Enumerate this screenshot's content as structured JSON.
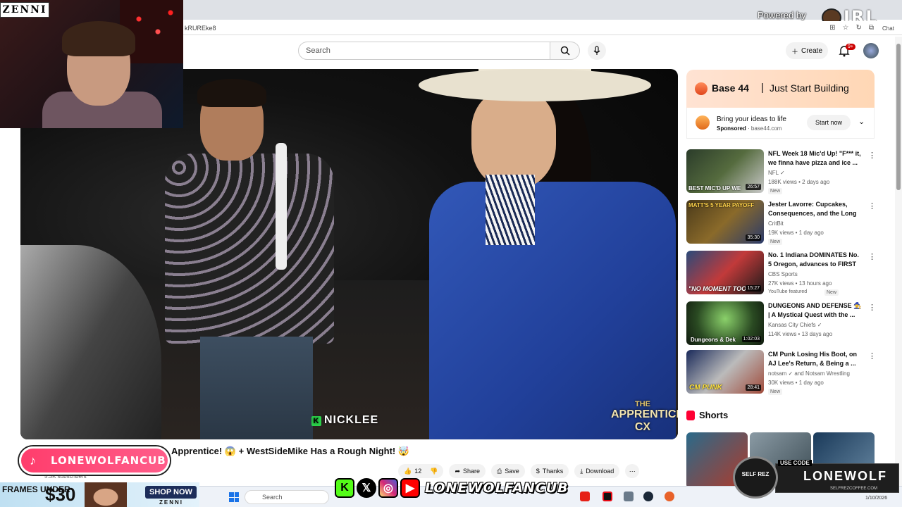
{
  "browser": {
    "url_fragment": "kRUREke8",
    "powered_by": "Powered by",
    "logo_text": "IRL",
    "chat_label": "Chat"
  },
  "youtube_header": {
    "search_placeholder": "Search",
    "create_label": "Create",
    "notifications_badge": "9+"
  },
  "video": {
    "caption_name": "NICKLEE",
    "caption_icon_letter": "K",
    "watermark_line1": "THE",
    "watermark_line2": "APPRENTICE",
    "watermark_line3": "CX",
    "title": "Apprentice! 😱 + WestSideMike Has a Rough Night! 🤯",
    "subscribers": "5.3K subscribers",
    "likes": "12",
    "share_label": "Share",
    "save_label": "Save",
    "thanks_label": "Thanks",
    "download_label": "Download"
  },
  "ad": {
    "brand": "Base 44",
    "separator": "|",
    "tagline": "Just Start Building",
    "headline": "Bring your ideas to life",
    "sponsored": "Sponsored",
    "domain": "base44.com",
    "cta": "Start now"
  },
  "recommendations": [
    {
      "title": "NFL Week 18 Mic'd Up! \"F*** it, we finna have pizza and ice ...",
      "channel": "NFL ✓",
      "meta": "188K views • 2 days ago",
      "badge": "New",
      "duration": "26:57",
      "thumb_text": "BEST MIC'D UP WE"
    },
    {
      "title": "Jester Lavorre: Cupcakes, Consequences, and the Long ...",
      "channel": "CritBit",
      "meta": "19K views • 1 day ago",
      "badge": "New",
      "duration": "35:30",
      "thumb_text": "MATT'S 5 YEAR PAYOFF"
    },
    {
      "title": "No. 1 Indiana DOMINATES No. 5 Oregon, advances to FIRST ...",
      "channel": "CBS Sports",
      "meta": "27K views • 13 hours ago",
      "badge": "New",
      "extra": "YouTube featured",
      "duration": "15:27",
      "thumb_text": "\"NO MOMENT TOO"
    },
    {
      "title": "DUNGEONS AND DEFENSE 🧙 | A Mystical Quest with the ...",
      "channel": "Kansas City Chiefs ✓",
      "meta": "114K views • 13 days ago",
      "badge": "",
      "duration": "1:02:03",
      "thumb_text": "Dungeons & Dek"
    },
    {
      "title": "CM Punk Losing His Boot, on AJ Lee's Return, & Being a ...",
      "channel": "notsam ✓ and Notsam Wrestling",
      "meta": "30K views • 1 day ago",
      "badge": "New",
      "duration": "28:41",
      "thumb_text": "CM PUNK"
    }
  ],
  "shorts": {
    "title": "Shorts"
  },
  "overlays": {
    "zenni": "ZENNI",
    "tiktok_handle": "LONEWOLFANCUB",
    "frames_under": "FRAMES UNDER",
    "frames_price": "$30",
    "shop_now": "SHOP NOW",
    "zenni_small": "ZENNI",
    "social_handle": "LONEWOLFANCUB",
    "badge_code": "USE CODE",
    "badge_name": "LONEWOLF",
    "badge_brand": "SELF REZ",
    "badge_url": "SELFREZCOFFEE.COM"
  },
  "taskbar": {
    "search_label": "Search",
    "date": "1/10/2026"
  }
}
